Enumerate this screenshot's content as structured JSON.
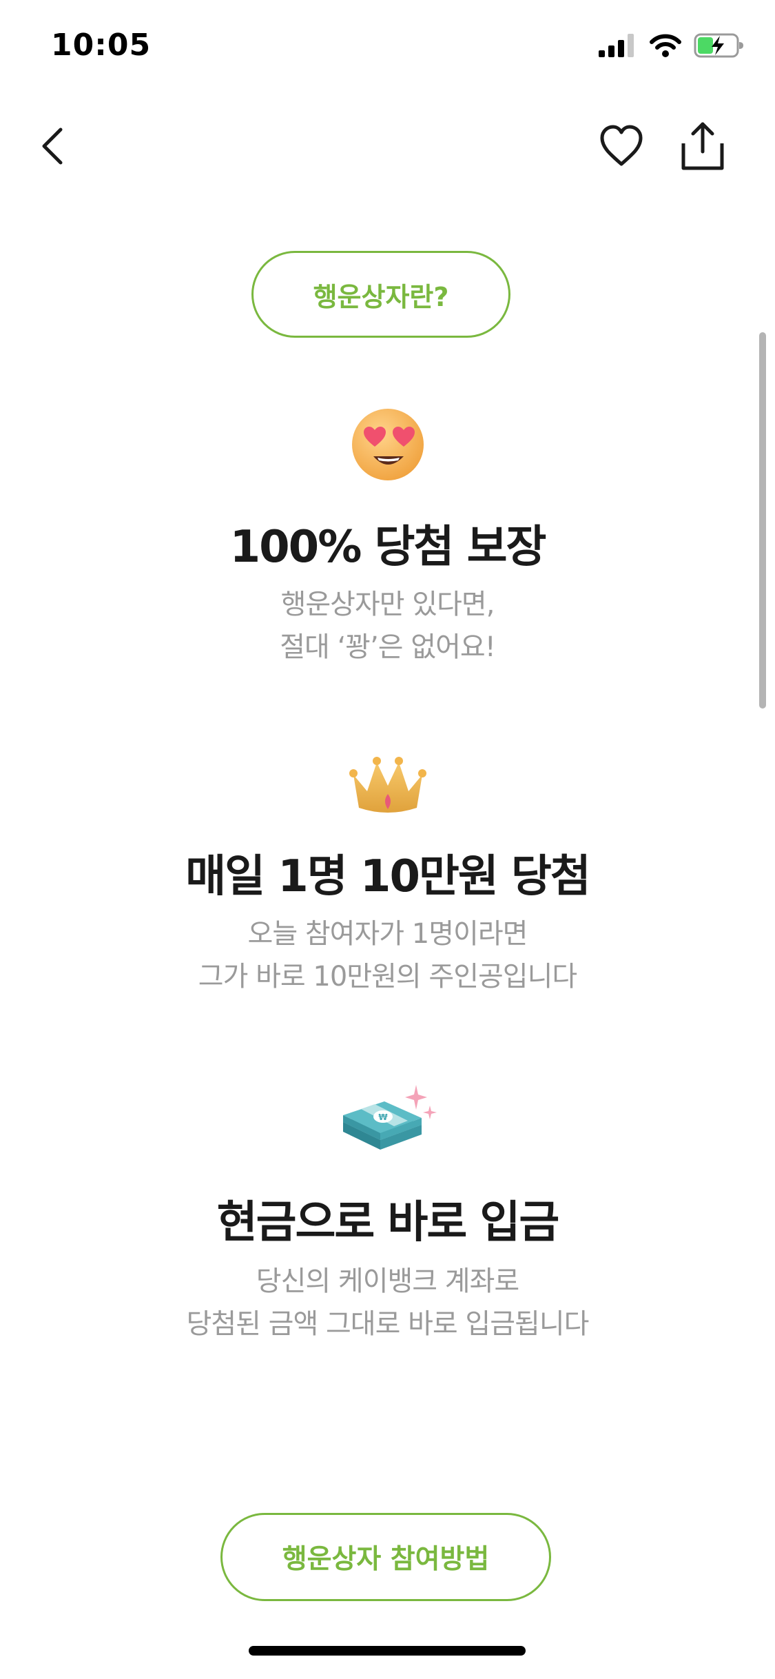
{
  "status_bar": {
    "time": "10:05",
    "icons": [
      "signal-icon",
      "wifi-icon",
      "battery-charging-icon"
    ]
  },
  "nav": {
    "icons": [
      "chevron-left-icon",
      "heart-icon",
      "share-icon"
    ]
  },
  "intro_button": {
    "label": "행운상자란?"
  },
  "features": [
    {
      "icon": "heart-eyes-emoji-icon",
      "title": "100% 당첨 보장",
      "desc_line1": "행운상자만 있다면,",
      "desc_line2": "절대 ‘꽝’은 없어요!"
    },
    {
      "icon": "crown-icon",
      "title": "매일 1명 10만원 당첨",
      "desc_line1": "오늘 참여자가 1명이라면",
      "desc_line2": "그가 바로 10만원의 주인공입니다"
    },
    {
      "icon": "money-stack-icon",
      "title": "현금으로 바로 입금",
      "desc_line1": "당신의 케이뱅크 계좌로",
      "desc_line2": "당첨된 금액 그대로 바로 입금됩니다"
    }
  ],
  "howto_button": {
    "label": "행운상자 참여방법"
  },
  "colors": {
    "accent": "#7ab83f",
    "title_text": "#1a1a1a",
    "desc_text": "#9a9a9a"
  }
}
